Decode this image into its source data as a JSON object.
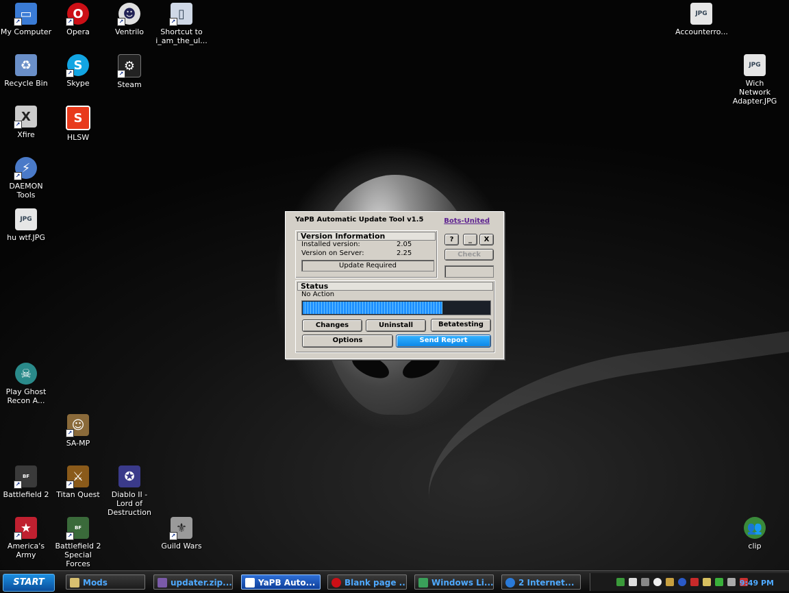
{
  "desktop_icons": [
    {
      "label": "My Computer",
      "icon": "computer-icon",
      "color": "#3a7bd5"
    },
    {
      "label": "Opera",
      "icon": "opera-icon",
      "color": "#cc0f16"
    },
    {
      "label": "Ventrilo",
      "icon": "ventrilo-icon",
      "color": "#e0e0e0"
    },
    {
      "label": "Shortcut to i_am_the_ul...",
      "icon": "shortcut-icon",
      "color": "#cfd8e6"
    },
    {
      "label": "Recycle Bin",
      "icon": "recycle-bin-icon",
      "color": "#6a8fc8"
    },
    {
      "label": "Skype",
      "icon": "skype-icon",
      "color": "#12a5e3"
    },
    {
      "label": "Steam",
      "icon": "steam-icon",
      "color": "#222222"
    },
    {
      "label": "Xfire",
      "icon": "xfire-icon",
      "color": "#cccccc"
    },
    {
      "label": "HLSW",
      "icon": "hlsw-icon",
      "color": "#e83a1c"
    },
    {
      "label": "DAEMON Tools",
      "icon": "daemon-tools-icon",
      "color": "#4a7ac8"
    },
    {
      "label": "hu wtf.JPG",
      "icon": "jpg-file-icon",
      "color": "#e6e6e6"
    },
    {
      "label": "Play Ghost Recon A...",
      "icon": "ghost-recon-icon",
      "color": "#2a8a8a"
    },
    {
      "label": "SA-MP",
      "icon": "samp-icon",
      "color": "#8a6a3a"
    },
    {
      "label": "Battlefield 2",
      "icon": "battlefield-icon",
      "color": "#3a3a3a"
    },
    {
      "label": "Titan Quest",
      "icon": "titan-quest-icon",
      "color": "#8a5a1a"
    },
    {
      "label": "Diablo II - Lord of Destruction",
      "icon": "diablo-icon",
      "color": "#3a3a8a"
    },
    {
      "label": "America's Army",
      "icon": "americas-army-icon",
      "color": "#c02030"
    },
    {
      "label": "Battlefield 2 Special Forces",
      "icon": "battlefield-sf-icon",
      "color": "#3a6a3a"
    },
    {
      "label": "Guild Wars",
      "icon": "guild-wars-icon",
      "color": "#9a9a9a"
    },
    {
      "label": "Accounterro...",
      "icon": "jpg-file-icon",
      "color": "#e6e6e6"
    },
    {
      "label": "Wich Network Adapter.JPG",
      "icon": "jpg-file-icon",
      "color": "#e6e6e6"
    },
    {
      "label": "clip",
      "icon": "users-icon",
      "color": "#3a8a3a"
    }
  ],
  "dialog": {
    "title": "YaPB Automatic Update Tool v1.5",
    "link": "Bots-United",
    "version_info": {
      "header": "Version Information",
      "installed_label": "Installed version:",
      "installed_value": "2.05",
      "server_label": "Version on Server:",
      "server_value": "2.25",
      "status_text": "Update Required"
    },
    "buttons": {
      "help": "?",
      "minimize": "_",
      "close": "X",
      "check": "Check",
      "changes": "Changes",
      "uninstall": "Uninstall",
      "betatesting": "Betatesting",
      "options": "Options",
      "send_report": "Send Report"
    },
    "status": {
      "header": "Status",
      "text": "No Action",
      "progress": 0.74
    }
  },
  "taskbar": {
    "start_label": "START",
    "tasks": [
      {
        "label": "Mods",
        "icon": "folder-icon",
        "active": false
      },
      {
        "label": "updater.zip...",
        "icon": "zip-icon",
        "active": false
      },
      {
        "label": "YaPB Auto...",
        "icon": "app-icon",
        "active": true
      },
      {
        "label": "Blank page ...",
        "icon": "opera-icon",
        "active": false
      },
      {
        "label": "Windows Li...",
        "icon": "messenger-icon",
        "active": false
      },
      {
        "label": "2 Internet...",
        "icon": "ie-icon",
        "active": false
      }
    ],
    "clock": "9:49 PM"
  }
}
